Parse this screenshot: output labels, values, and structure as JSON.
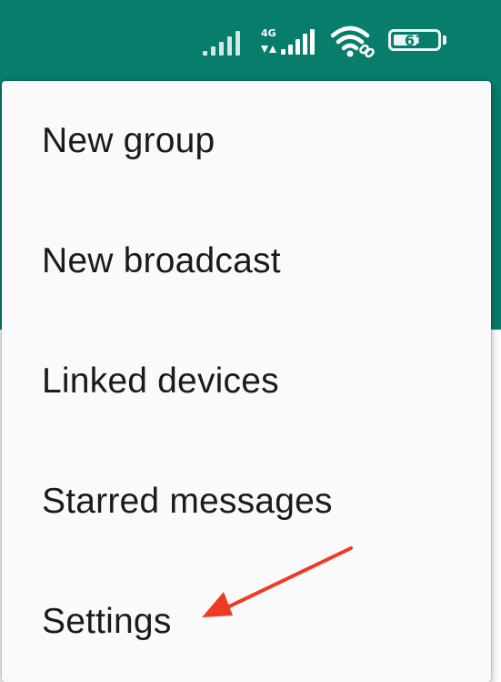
{
  "status_bar": {
    "network_type": "4G",
    "battery_level": "61",
    "battery_fraction": 0.61,
    "icons": [
      "signal-strength-icon",
      "mobile-data-4g-icon",
      "wifi-icon",
      "battery-icon"
    ]
  },
  "colors": {
    "header_background": "#087d6b",
    "menu_background": "#fafafa",
    "menu_text": "#1b1b1b",
    "annotation_arrow": "#ee3b23"
  },
  "menu": {
    "items": [
      {
        "label": "New group"
      },
      {
        "label": "New broadcast"
      },
      {
        "label": "Linked devices"
      },
      {
        "label": "Starred messages"
      },
      {
        "label": "Settings"
      }
    ]
  }
}
